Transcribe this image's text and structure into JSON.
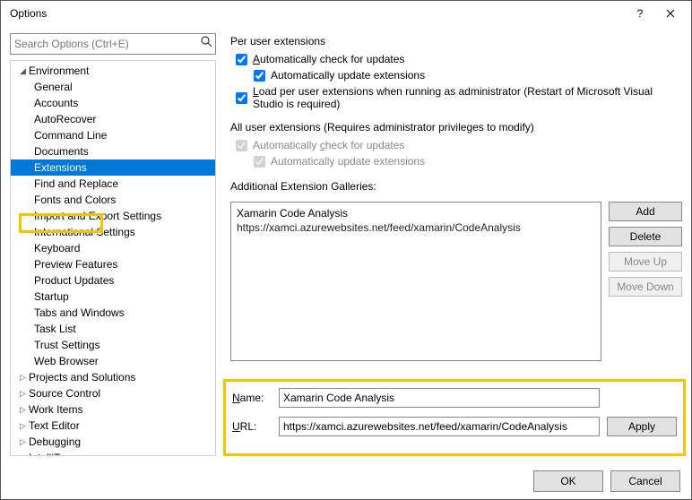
{
  "window": {
    "title": "Options"
  },
  "search": {
    "placeholder": "Search Options (Ctrl+E)"
  },
  "tree": {
    "root": "Environment",
    "items": [
      "General",
      "Accounts",
      "AutoRecover",
      "Command Line",
      "Documents",
      "Extensions",
      "Find and Replace",
      "Fonts and Colors",
      "Import and Export Settings",
      "International Settings",
      "Keyboard",
      "Preview Features",
      "Product Updates",
      "Startup",
      "Tabs and Windows",
      "Task List",
      "Trust Settings",
      "Web Browser"
    ],
    "selected": "Extensions",
    "groups": [
      "Projects and Solutions",
      "Source Control",
      "Work Items",
      "Text Editor",
      "Debugging",
      "IntelliTrace"
    ]
  },
  "perUser": {
    "heading": "Per user extensions",
    "autoCheck": "utomatically check for updates",
    "autoCheckAccess": "A",
    "autoUpdate": "Automatically update extensions",
    "loadAdmin": "oad per user extensions when running as administrator (Restart of Microsoft Visual Studio is required)",
    "loadAdminAccess": "L"
  },
  "allUser": {
    "heading": "All user extensions (Requires administrator privileges to modify)",
    "autoCheck": "heck for updates",
    "autoCheckPrefix": "Automatically ",
    "autoCheckAccess": "c",
    "autoUpdate": "Automatically update extensions"
  },
  "galleries": {
    "heading": "Additional Extension Galleries:",
    "item": {
      "name": "Xamarin Code Analysis",
      "url": "https://xamci.azurewebsites.net/feed/xamarin/CodeAnalysis"
    },
    "buttons": {
      "add": "dd",
      "addAccess": "A",
      "delete": "elete",
      "deleteAccess": "D",
      "moveUp": "Move Up",
      "moveDown": "Move Down"
    }
  },
  "form": {
    "nameLabel": "ame:",
    "nameAccess": "N",
    "urlLabel": "RL:",
    "urlAccess": "U",
    "name": "Xamarin Code Analysis",
    "url": "https://xamci.azurewebsites.net/feed/xamarin/CodeAnalysis",
    "apply": "Apply"
  },
  "footer": {
    "ok": "OK",
    "cancel": "Cancel"
  }
}
